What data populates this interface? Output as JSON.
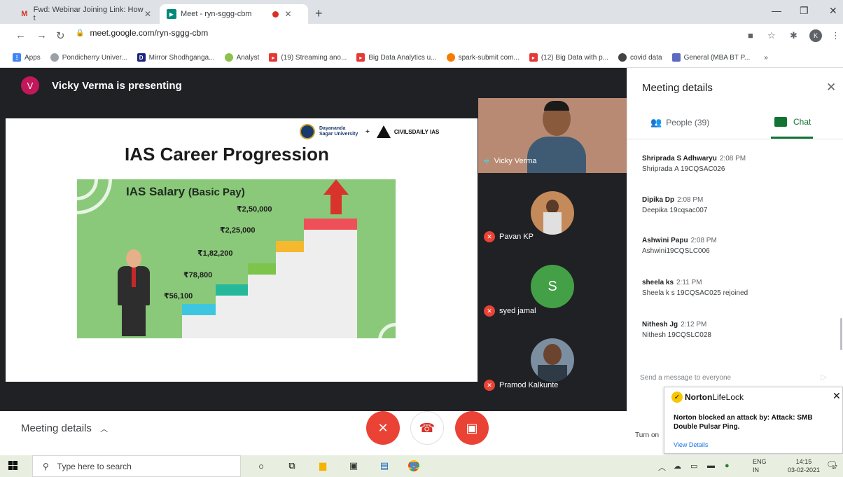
{
  "browser": {
    "tabs": [
      {
        "label": "Fwd: Webinar Joining Link: How t",
        "favicon": "gmail-icon"
      },
      {
        "label": "Meet - ryn-sggg-cbm",
        "favicon": "meet-icon"
      }
    ],
    "url": "meet.google.com/ryn-sggg-cbm",
    "profile_initial": "K",
    "bookmarks": [
      {
        "label": "Apps",
        "color": "#4285f4"
      },
      {
        "label": "Pondicherry Univer...",
        "color": "#9aa0a6"
      },
      {
        "label": "Mirror Shodhganga...",
        "color": "#1a237e"
      },
      {
        "label": "Analyst",
        "color": "#8bc34a"
      },
      {
        "label": "(19) Streaming ano...",
        "color": "#e53935"
      },
      {
        "label": "Big Data Analytics u...",
        "color": "#e53935"
      },
      {
        "label": "spark-submit com...",
        "color": "#f57c00"
      },
      {
        "label": "(12) Big Data with p...",
        "color": "#e53935"
      },
      {
        "label": "covid data",
        "color": "#424242"
      },
      {
        "label": "General (MBA BT P...",
        "color": "#5c6bc0"
      }
    ],
    "bookmarks_more": "»"
  },
  "meet": {
    "presenter_initial": "V",
    "presenting_text": "Vicky Verma is presenting",
    "slide": {
      "logo_left": "Dayananda Sagar University",
      "logo_plus": "+",
      "logo_right": "CIVILSDAILY IAS",
      "title": "IAS Career Progression",
      "panel_title": "IAS Salary",
      "panel_subtitle": "(Basic Pay)",
      "salaries": [
        "₹56,100",
        "₹78,800",
        "₹1,82,200",
        "₹2,25,000",
        "₹2,50,000"
      ]
    },
    "participants": [
      {
        "name": "Vicky Verma",
        "muted": false
      },
      {
        "name": "Pavan KP",
        "muted": true
      },
      {
        "name": "syed jamal",
        "muted": true,
        "initial": "S"
      },
      {
        "name": "Pramod Kalkunte",
        "muted": true
      }
    ],
    "panel": {
      "title": "Meeting details",
      "people_tab": "People (39)",
      "chat_tab": "Chat",
      "messages": [
        {
          "who": "Shripradа S Adhwaryu",
          "time": "2:08 PM",
          "text": "Shripradа A 19CQSAC026"
        },
        {
          "who": "Dipika Dp",
          "time": "2:08 PM",
          "text": "Deepika 19cqsac007"
        },
        {
          "who": "Ashwini Papu",
          "time": "2:08 PM",
          "text": "Ashwini19CQSLC006"
        },
        {
          "who": "sheela ks",
          "time": "2:11 PM",
          "text": "Sheela k s 19CQSAC025 rejoined"
        },
        {
          "who": "Nithesh Jg",
          "time": "2:12 PM",
          "text": "Nithesh 19CQSLC028"
        }
      ],
      "send_placeholder": "Send a message to everyone"
    },
    "bottom": {
      "meeting_details": "Meeting details",
      "turn_on": "Turn on"
    }
  },
  "norton": {
    "brand_bold": "Norton",
    "brand_light": "LifeLock",
    "message": "Norton blocked an attack by: Attack: SMB Double Pulsar Ping.",
    "link": "View Details"
  },
  "taskbar": {
    "search_placeholder": "Type here to search",
    "lang_top": "ENG",
    "lang_bottom": "IN",
    "time": "14:15",
    "date": "03-02-2021",
    "notification_count": "17"
  }
}
